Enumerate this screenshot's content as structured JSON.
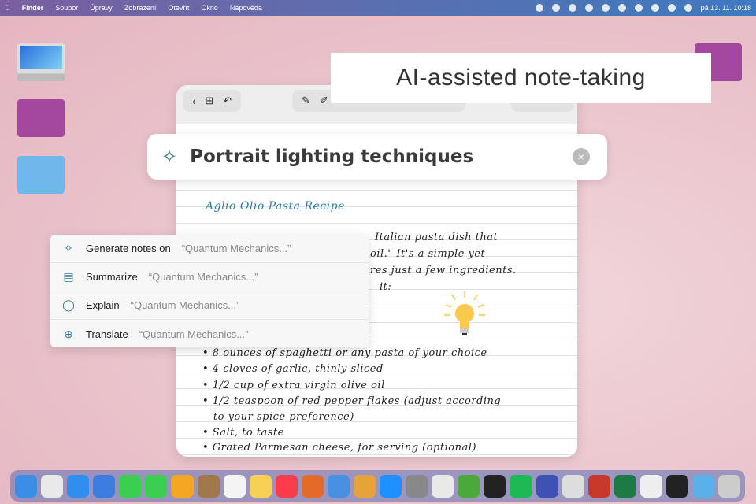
{
  "menubar": {
    "app": "Finder",
    "items": [
      "Soubor",
      "Úpravy",
      "Zobrazení",
      "Otevřít",
      "Okno",
      "Nápověda"
    ],
    "clock": "pá 13. 11.  10:18"
  },
  "banner": "AI-assisted note-taking",
  "search": {
    "query": "Portrait lighting techniques",
    "clear": "×"
  },
  "note": {
    "title": "Aglio Olio Pasta Recipe",
    "fragments": [
      "Italian pasta dish that",
      "oil.\" It's a simple yet",
      "res just a few ingredients.",
      "it:"
    ],
    "ingredients": [
      "• 8 ounces of spaghetti or any pasta of your choice",
      "• 4 cloves of garlic, thinly sliced",
      "• 1/2 cup of extra virgin olive oil",
      "• 1/2 teaspoon of red pepper flakes (adjust according",
      "   to your spice preference)",
      "• Salt, to taste",
      "• Grated Parmesan cheese, for serving (optional)"
    ]
  },
  "ai_menu": [
    {
      "label": "Generate notes on",
      "context": "“Quantum Mechanics...”",
      "icon": "✧"
    },
    {
      "label": "Summarize",
      "context": "“Quantum Mechanics...”",
      "icon": "▤"
    },
    {
      "label": "Explain",
      "context": "“Quantum Mechanics...”",
      "icon": "◯"
    },
    {
      "label": "Translate",
      "context": "“Quantum Mechanics...”",
      "icon": "⊕"
    }
  ],
  "dock_colors": [
    "#3a8ee6",
    "#e9e9e9",
    "#2f8ef0",
    "#3d7de0",
    "#3bcf52",
    "#3bcf52",
    "#f5a623",
    "#a0784a",
    "#f4f4f4",
    "#f7d154",
    "#fa3c4c",
    "#e46a2a",
    "#4a90e2",
    "#e8a23b",
    "#1e90ff",
    "#888",
    "#e9e9e9",
    "#4aa93a",
    "#222",
    "#1db954",
    "#3f51b5",
    "#ddd",
    "#c8382b",
    "#1d7a45",
    "#eee",
    "#222",
    "#5ab0e8",
    "#ccc"
  ]
}
